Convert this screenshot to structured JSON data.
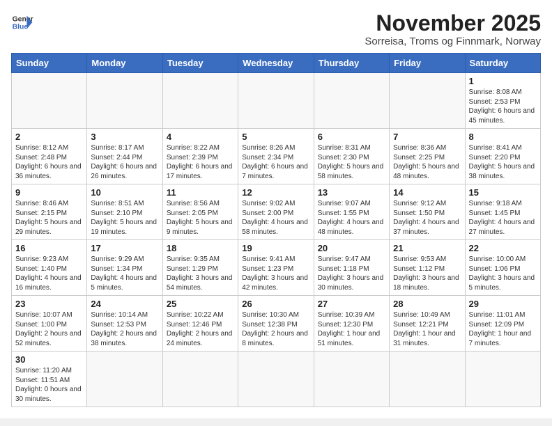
{
  "header": {
    "logo_line1": "General",
    "logo_line2": "Blue",
    "month_title": "November 2025",
    "location": "Sorreisa, Troms og Finnmark, Norway"
  },
  "weekdays": [
    "Sunday",
    "Monday",
    "Tuesday",
    "Wednesday",
    "Thursday",
    "Friday",
    "Saturday"
  ],
  "weeks": [
    [
      {
        "day": "",
        "info": ""
      },
      {
        "day": "",
        "info": ""
      },
      {
        "day": "",
        "info": ""
      },
      {
        "day": "",
        "info": ""
      },
      {
        "day": "",
        "info": ""
      },
      {
        "day": "",
        "info": ""
      },
      {
        "day": "1",
        "info": "Sunrise: 8:08 AM\nSunset: 2:53 PM\nDaylight: 6 hours and 45 minutes."
      }
    ],
    [
      {
        "day": "2",
        "info": "Sunrise: 8:12 AM\nSunset: 2:48 PM\nDaylight: 6 hours and 36 minutes."
      },
      {
        "day": "3",
        "info": "Sunrise: 8:17 AM\nSunset: 2:44 PM\nDaylight: 6 hours and 26 minutes."
      },
      {
        "day": "4",
        "info": "Sunrise: 8:22 AM\nSunset: 2:39 PM\nDaylight: 6 hours and 17 minutes."
      },
      {
        "day": "5",
        "info": "Sunrise: 8:26 AM\nSunset: 2:34 PM\nDaylight: 6 hours and 7 minutes."
      },
      {
        "day": "6",
        "info": "Sunrise: 8:31 AM\nSunset: 2:30 PM\nDaylight: 5 hours and 58 minutes."
      },
      {
        "day": "7",
        "info": "Sunrise: 8:36 AM\nSunset: 2:25 PM\nDaylight: 5 hours and 48 minutes."
      },
      {
        "day": "8",
        "info": "Sunrise: 8:41 AM\nSunset: 2:20 PM\nDaylight: 5 hours and 38 minutes."
      }
    ],
    [
      {
        "day": "9",
        "info": "Sunrise: 8:46 AM\nSunset: 2:15 PM\nDaylight: 5 hours and 29 minutes."
      },
      {
        "day": "10",
        "info": "Sunrise: 8:51 AM\nSunset: 2:10 PM\nDaylight: 5 hours and 19 minutes."
      },
      {
        "day": "11",
        "info": "Sunrise: 8:56 AM\nSunset: 2:05 PM\nDaylight: 5 hours and 9 minutes."
      },
      {
        "day": "12",
        "info": "Sunrise: 9:02 AM\nSunset: 2:00 PM\nDaylight: 4 hours and 58 minutes."
      },
      {
        "day": "13",
        "info": "Sunrise: 9:07 AM\nSunset: 1:55 PM\nDaylight: 4 hours and 48 minutes."
      },
      {
        "day": "14",
        "info": "Sunrise: 9:12 AM\nSunset: 1:50 PM\nDaylight: 4 hours and 37 minutes."
      },
      {
        "day": "15",
        "info": "Sunrise: 9:18 AM\nSunset: 1:45 PM\nDaylight: 4 hours and 27 minutes."
      }
    ],
    [
      {
        "day": "16",
        "info": "Sunrise: 9:23 AM\nSunset: 1:40 PM\nDaylight: 4 hours and 16 minutes."
      },
      {
        "day": "17",
        "info": "Sunrise: 9:29 AM\nSunset: 1:34 PM\nDaylight: 4 hours and 5 minutes."
      },
      {
        "day": "18",
        "info": "Sunrise: 9:35 AM\nSunset: 1:29 PM\nDaylight: 3 hours and 54 minutes."
      },
      {
        "day": "19",
        "info": "Sunrise: 9:41 AM\nSunset: 1:23 PM\nDaylight: 3 hours and 42 minutes."
      },
      {
        "day": "20",
        "info": "Sunrise: 9:47 AM\nSunset: 1:18 PM\nDaylight: 3 hours and 30 minutes."
      },
      {
        "day": "21",
        "info": "Sunrise: 9:53 AM\nSunset: 1:12 PM\nDaylight: 3 hours and 18 minutes."
      },
      {
        "day": "22",
        "info": "Sunrise: 10:00 AM\nSunset: 1:06 PM\nDaylight: 3 hours and 5 minutes."
      }
    ],
    [
      {
        "day": "23",
        "info": "Sunrise: 10:07 AM\nSunset: 1:00 PM\nDaylight: 2 hours and 52 minutes."
      },
      {
        "day": "24",
        "info": "Sunrise: 10:14 AM\nSunset: 12:53 PM\nDaylight: 2 hours and 38 minutes."
      },
      {
        "day": "25",
        "info": "Sunrise: 10:22 AM\nSunset: 12:46 PM\nDaylight: 2 hours and 24 minutes."
      },
      {
        "day": "26",
        "info": "Sunrise: 10:30 AM\nSunset: 12:38 PM\nDaylight: 2 hours and 8 minutes."
      },
      {
        "day": "27",
        "info": "Sunrise: 10:39 AM\nSunset: 12:30 PM\nDaylight: 1 hour and 51 minutes."
      },
      {
        "day": "28",
        "info": "Sunrise: 10:49 AM\nSunset: 12:21 PM\nDaylight: 1 hour and 31 minutes."
      },
      {
        "day": "29",
        "info": "Sunrise: 11:01 AM\nSunset: 12:09 PM\nDaylight: 1 hour and 7 minutes."
      }
    ],
    [
      {
        "day": "30",
        "info": "Sunrise: 11:20 AM\nSunset: 11:51 AM\nDaylight: 0 hours and 30 minutes."
      },
      {
        "day": "",
        "info": ""
      },
      {
        "day": "",
        "info": ""
      },
      {
        "day": "",
        "info": ""
      },
      {
        "day": "",
        "info": ""
      },
      {
        "day": "",
        "info": ""
      },
      {
        "day": "",
        "info": ""
      }
    ]
  ]
}
